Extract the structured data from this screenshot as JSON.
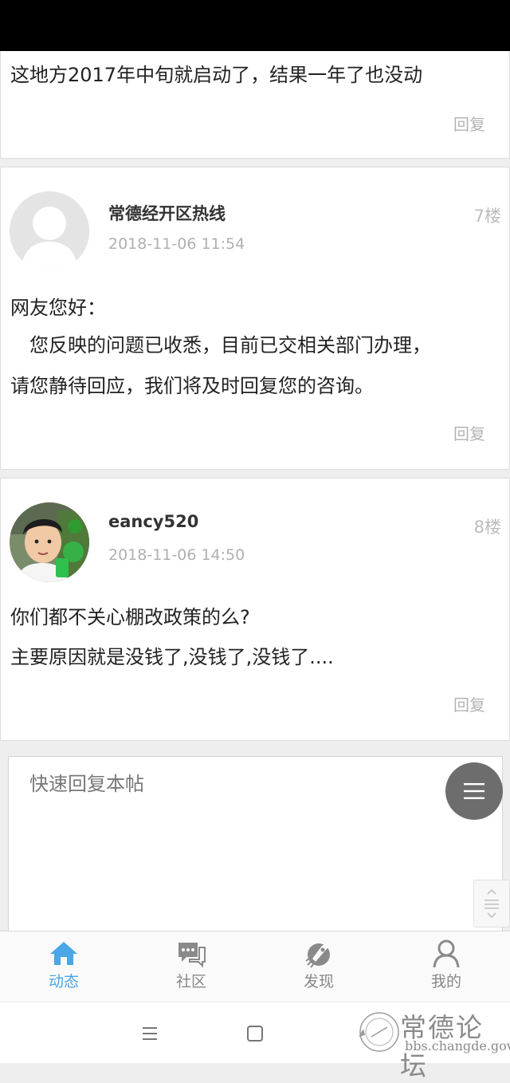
{
  "thread": {
    "posts": [
      {
        "content_lines": [
          "这地方2017年中旬就启动了，结果一年了也没动"
        ],
        "reply_label": "回复"
      },
      {
        "author": "常德经开区热线",
        "time": "2018-11-06 11:54",
        "floor": "7楼",
        "avatar": "default-avatar",
        "content_lines": [
          "网友您好：",
          "　您反映的问题已收悉，目前已交相关部门办理，",
          "请您静待回应，我们将及时回复您的咨询。"
        ],
        "reply_label": "回复"
      },
      {
        "author": "eancy520",
        "time": "2018-11-06 14:50",
        "floor": "8楼",
        "avatar": "user-photo-avatar",
        "content_lines": [
          "你们都不关心棚改政策的么?",
          "主要原因就是没钱了,没钱了,没钱了...."
        ],
        "reply_label": "回复"
      }
    ]
  },
  "quick_reply": {
    "placeholder": "快速回复本帖"
  },
  "fab": {
    "icon": "menu-icon"
  },
  "tab_bar": {
    "active_color": "#4aa6e6",
    "items": [
      {
        "label": "动态",
        "icon": "home-icon",
        "active": true
      },
      {
        "label": "社区",
        "icon": "chat-bubbles-icon",
        "active": false
      },
      {
        "label": "发现",
        "icon": "rocket-icon",
        "active": false
      },
      {
        "label": "我的",
        "icon": "person-icon",
        "active": false
      }
    ]
  },
  "watermark": {
    "title": "常德论坛",
    "url": "bbs.changde.gov.cn",
    "seal_text": "常德论坛 bbs.changde.gov.cn"
  }
}
